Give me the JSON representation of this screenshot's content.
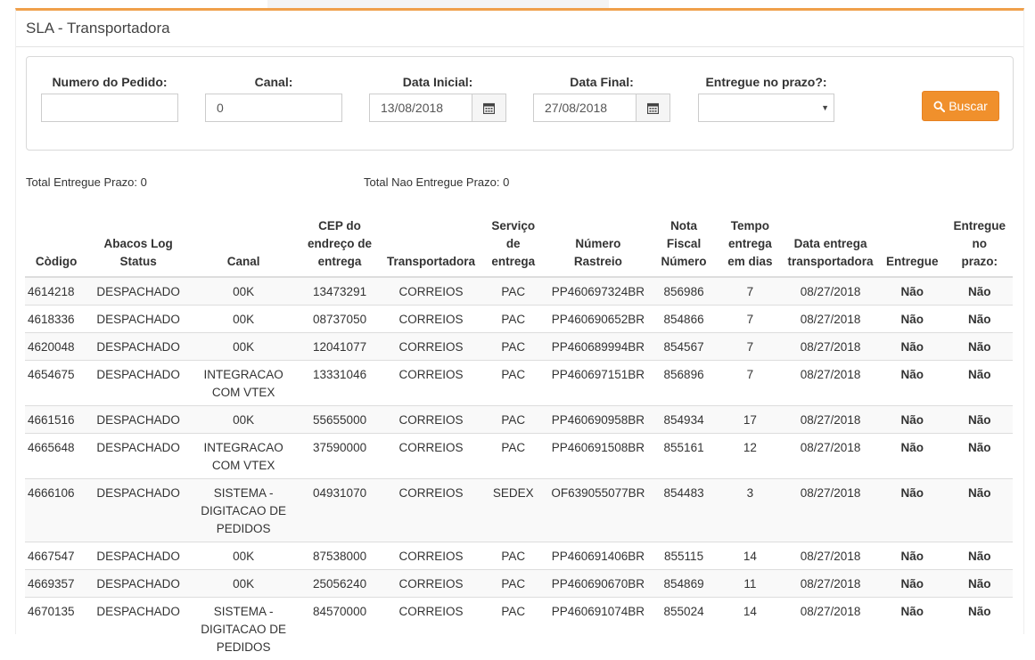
{
  "page": {
    "title": "SLA - Transportadora"
  },
  "filters": {
    "numero_pedido": {
      "label": "Numero do Pedido:",
      "value": ""
    },
    "canal": {
      "label": "Canal:",
      "value": "0"
    },
    "data_inicial": {
      "label": "Data Inicial:",
      "value": "13/08/2018"
    },
    "data_final": {
      "label": "Data Final:",
      "value": "27/08/2018"
    },
    "entregue_prazo": {
      "label": "Entregue no prazo?:",
      "value": ""
    },
    "buscar_label": "Buscar"
  },
  "totals": {
    "entregue": "Total Entregue Prazo: 0",
    "nao_entregue": "Total Nao Entregue Prazo: 0"
  },
  "table": {
    "headers": [
      [
        "Còdigo"
      ],
      [
        "Abacos Log",
        "Status"
      ],
      [
        "Canal"
      ],
      [
        "CEP do",
        "endreço de",
        "entrega"
      ],
      [
        "Transportadora"
      ],
      [
        "Serviço",
        "de",
        "entrega"
      ],
      [
        "Número",
        "Rastreio"
      ],
      [
        "Nota",
        "Fiscal",
        "Número"
      ],
      [
        "Tempo",
        "entrega",
        "em dias"
      ],
      [
        "Data entrega",
        "transportadora"
      ],
      [
        "Entregue"
      ],
      [
        "Entregue",
        "no",
        "prazo:"
      ]
    ],
    "rows": [
      [
        "4614218",
        "DESPACHADO",
        "00K",
        "13473291",
        "CORREIOS",
        "PAC",
        "PP460697324BR",
        "856986",
        "7",
        "08/27/2018",
        "Não",
        "Não"
      ],
      [
        "4618336",
        "DESPACHADO",
        "00K",
        "08737050",
        "CORREIOS",
        "PAC",
        "PP460690652BR",
        "854866",
        "7",
        "08/27/2018",
        "Não",
        "Não"
      ],
      [
        "4620048",
        "DESPACHADO",
        "00K",
        "12041077",
        "CORREIOS",
        "PAC",
        "PP460689994BR",
        "854567",
        "7",
        "08/27/2018",
        "Não",
        "Não"
      ],
      [
        "4654675",
        "DESPACHADO",
        "INTEGRACAO COM VTEX",
        "13331046",
        "CORREIOS",
        "PAC",
        "PP460697151BR",
        "856896",
        "7",
        "08/27/2018",
        "Não",
        "Não"
      ],
      [
        "4661516",
        "DESPACHADO",
        "00K",
        "55655000",
        "CORREIOS",
        "PAC",
        "PP460690958BR",
        "854934",
        "17",
        "08/27/2018",
        "Não",
        "Não"
      ],
      [
        "4665648",
        "DESPACHADO",
        "INTEGRACAO COM VTEX",
        "37590000",
        "CORREIOS",
        "PAC",
        "PP460691508BR",
        "855161",
        "12",
        "08/27/2018",
        "Não",
        "Não"
      ],
      [
        "4666106",
        "DESPACHADO",
        "SISTEMA - DIGITACAO DE PEDIDOS",
        "04931070",
        "CORREIOS",
        "SEDEX",
        "OF639055077BR",
        "854483",
        "3",
        "08/27/2018",
        "Não",
        "Não"
      ],
      [
        "4667547",
        "DESPACHADO",
        "00K",
        "87538000",
        "CORREIOS",
        "PAC",
        "PP460691406BR",
        "855115",
        "14",
        "08/27/2018",
        "Não",
        "Não"
      ],
      [
        "4669357",
        "DESPACHADO",
        "00K",
        "25056240",
        "CORREIOS",
        "PAC",
        "PP460690670BR",
        "854869",
        "11",
        "08/27/2018",
        "Não",
        "Não"
      ],
      [
        "4670135",
        "DESPACHADO",
        "SISTEMA - DIGITACAO DE PEDIDOS",
        "84570000",
        "CORREIOS",
        "PAC",
        "PP460691074BR",
        "855024",
        "14",
        "08/27/2018",
        "Não",
        "Não"
      ]
    ]
  },
  "colors": {
    "accent": "#f0902c",
    "border_top": "#f0a04b"
  }
}
